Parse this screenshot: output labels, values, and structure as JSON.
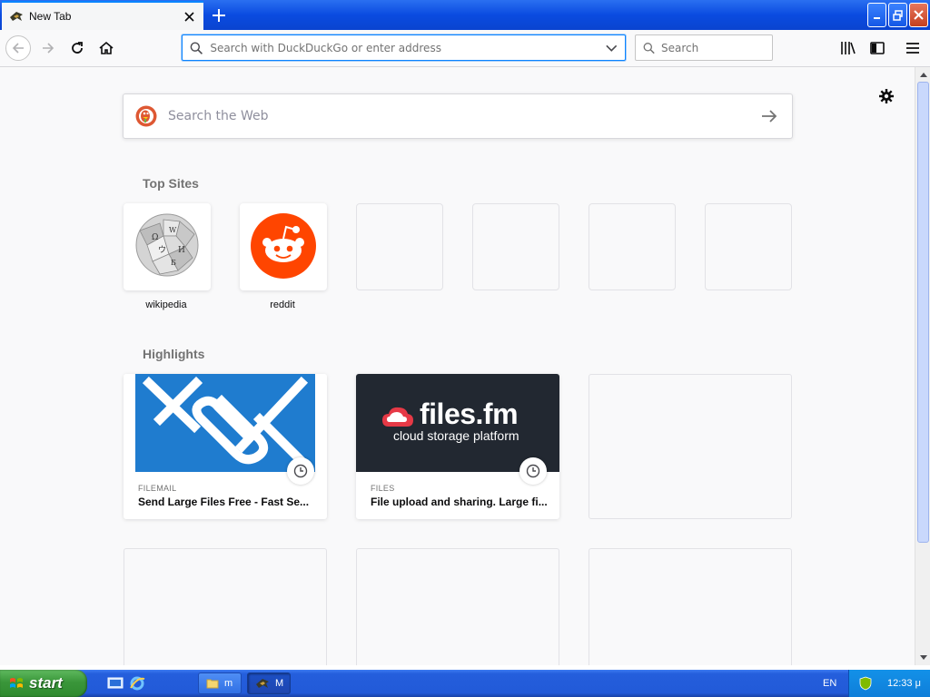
{
  "browser": {
    "tab": {
      "title": "New Tab"
    },
    "urlbar": {
      "placeholder": "Search with DuckDuckGo or enter address"
    },
    "searchbar": {
      "placeholder": "Search"
    }
  },
  "newtab": {
    "websearch_placeholder": "Search the Web",
    "top_sites_title": "Top Sites",
    "top_sites": [
      {
        "label": "wikipedia",
        "icon": "wikipedia-logo"
      },
      {
        "label": "reddit",
        "icon": "reddit-logo"
      }
    ],
    "highlights_title": "Highlights",
    "highlights": [
      {
        "source": "FILEMAIL",
        "title": "Send Large Files Free - Fast Se...",
        "image": "filemail-logo",
        "accent": "#1f7ccf"
      },
      {
        "source": "FILES",
        "title": "File upload and sharing. Large fi...",
        "image": "files-fm-logo",
        "accent": "#222831",
        "brand_name": "files.fm",
        "brand_tagline": "cloud storage platform"
      }
    ]
  },
  "taskbar": {
    "start_label": "start",
    "tasks": [
      {
        "label": "m",
        "icon": "folder-icon"
      },
      {
        "label": "M",
        "icon": "browser-icon"
      }
    ],
    "language": "EN",
    "clock": "12:33 μ"
  },
  "colors": {
    "accent": "#0a84ff",
    "reddit": "#ff4500",
    "duckduckgo": "#de5833"
  }
}
